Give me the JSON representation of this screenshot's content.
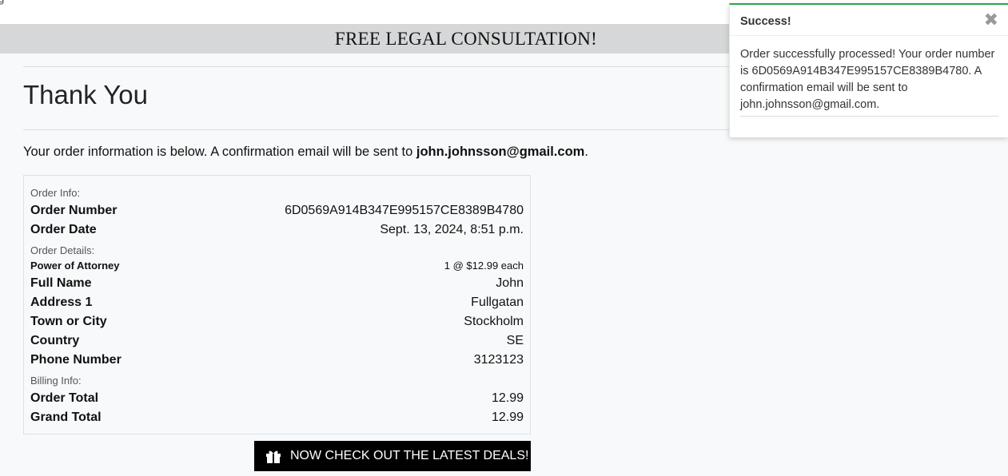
{
  "top": {
    "cut_text": "g"
  },
  "banner": {
    "text": "FREE LEGAL CONSULTATION!"
  },
  "page": {
    "title": "Thank You",
    "intro_prefix": "Your order information is below. A confirmation email will be sent to ",
    "intro_email": "john.johnsson@gmail.com",
    "intro_suffix": "."
  },
  "order": {
    "section_info": "Order Info:",
    "order_number_label": "Order Number",
    "order_number": "6D0569A914B347E995157CE8389B4780",
    "order_date_label": "Order Date",
    "order_date": "Sept. 13, 2024, 8:51 p.m.",
    "section_details": "Order Details:",
    "product_name": "Power of Attorney",
    "product_qty": "1 @ $12.99 each",
    "full_name_label": "Full Name",
    "full_name": "John",
    "address_label": "Address 1",
    "address": "Fullgatan",
    "town_label": "Town or City",
    "town": "Stockholm",
    "country_label": "Country",
    "country": "SE",
    "phone_label": "Phone Number",
    "phone": "3123123",
    "section_billing": "Billing Info:",
    "order_total_label": "Order Total",
    "order_total": "12.99",
    "grand_total_label": "Grand Total",
    "grand_total": "12.99"
  },
  "cta": {
    "label": "NOW CHECK OUT THE LATEST DEALS!",
    "icon": "gift-icon"
  },
  "toast": {
    "title": "Success!",
    "close_icon": "close-icon",
    "message": "Order successfully processed! Your order number is 6D0569A914B347E995157CE8389B4780. A confirmation email will be sent to john.johnsson@gmail.com.",
    "accent_color": "#28a745"
  }
}
